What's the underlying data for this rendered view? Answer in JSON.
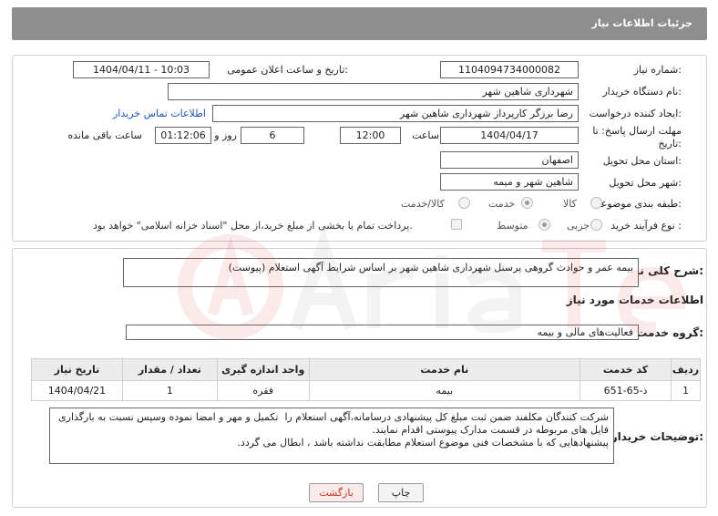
{
  "header": {
    "title": "جزئیات اطلاعات نیاز"
  },
  "form": {
    "need_number_label": "شماره نیاز:",
    "need_number": "1104094734000082",
    "announce_label": "تاریخ و ساعت اعلان عمومی:",
    "announce_value": "1404/04/11 - 10:03",
    "buyer_org_label": "نام دستگاه خریدار:",
    "buyer_org": "شهرداری شاهین شهر",
    "creator_label": "ایجاد کننده درخواست:",
    "creator": "رضا برزگر کارپرداز شهرداری شاهین شهر",
    "contact_link": "اطلاعات تماس خریدار",
    "deadline_label_1": "مهلت ارسال پاسخ: تا",
    "deadline_label_2": "تاریخ:",
    "deadline_date": "1404/04/17",
    "time_label": "ساعت",
    "deadline_time": "12:00",
    "days_value": "6",
    "days_label": "روز و",
    "remaining_value": "01:12:06",
    "remaining_label": "ساعت باقی مانده",
    "province_label": "استان محل تحویل:",
    "province": "اصفهان",
    "city_label": "شهر محل تحویل:",
    "city": "شاهین شهر و میمه",
    "category_label": "طبقه بندی موضوعی:",
    "category_options": [
      "کالا",
      "خدمت",
      "کالا/خدمت"
    ],
    "process_label": "نوع فرآیند خرید :",
    "process_options": [
      "جزیی",
      "متوسط"
    ],
    "payment_note": "پرداخت تمام یا بخشی از مبلغ خرید،از محل \"اسناد خزانه اسلامی\" خواهد بود."
  },
  "summary": {
    "label": "شرح کلی نیاز:",
    "text": "بیمه عمر و حوادث گروهی پرسنل شهرداری شاهین شهر بر اساس شرایط آگهی استعلام (پیوست)"
  },
  "services": {
    "section_title": "اطلاعات خدمات مورد نیاز",
    "group_label": "گروه خدمت:",
    "group_value": "فعالیت‌های مالی و بیمه",
    "columns": [
      "ردیف",
      "کد خدمت",
      "نام خدمت",
      "واحد اندازه گیری",
      "تعداد / مقدار",
      "تاریخ نیاز"
    ],
    "rows": [
      [
        "1",
        "ذ-65-651",
        "بیمه",
        "فقره",
        "1",
        "1404/04/21"
      ]
    ]
  },
  "buyer_notes": {
    "label": "توضیحات خریدار:",
    "text": "شرکت کنندگان مکلفند ضمن ثبت مبلغ کل پیشنهادی درسامانه،آگهی استعلام را  تکمیل و مهر و امضا نموده وسپس نسبت به بارگذاری فایل های مربوطه در قسمت مدارک پیوستی اقدام نمایند.\nپیشنهادهایی که با مشخصات فنی موضوع استعلام مطابقت نداشته باشد ، ابطال می گردد."
  },
  "buttons": {
    "print": "چاپ",
    "back": "بازگشت"
  },
  "colors": {
    "header_bg": "#8e8e8e",
    "link": "#1a56c6",
    "back_btn_text": "#c0392b"
  }
}
